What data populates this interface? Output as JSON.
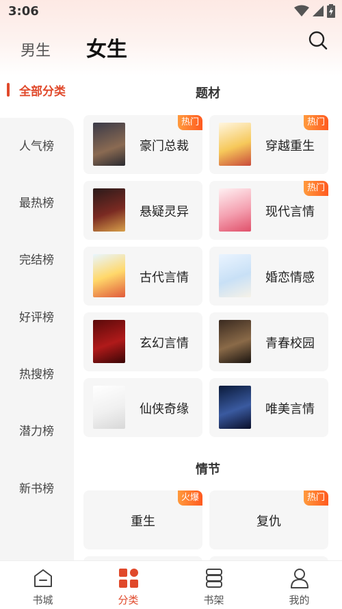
{
  "status_bar": {
    "time": "3:06"
  },
  "header": {
    "tab_male": "男生",
    "tab_female": "女生"
  },
  "sidebar": {
    "active": "全部分类",
    "items": [
      "人气榜",
      "最热榜",
      "完结榜",
      "好评榜",
      "热搜榜",
      "潜力榜",
      "新书榜"
    ]
  },
  "sections": {
    "theme": {
      "title": "题材",
      "cards": [
        {
          "name": "豪门总裁",
          "badge": "热门"
        },
        {
          "name": "穿越重生",
          "badge": "热门"
        },
        {
          "name": "悬疑灵异",
          "badge": ""
        },
        {
          "name": "现代言情",
          "badge": "热门"
        },
        {
          "name": "古代言情",
          "badge": ""
        },
        {
          "name": "婚恋情感",
          "badge": ""
        },
        {
          "name": "玄幻言情",
          "badge": ""
        },
        {
          "name": "青春校园",
          "badge": ""
        },
        {
          "name": "仙侠奇缘",
          "badge": ""
        },
        {
          "name": "唯美言情",
          "badge": ""
        }
      ]
    },
    "plot": {
      "title": "情节",
      "cards": [
        {
          "name": "重生",
          "badge": "火爆"
        },
        {
          "name": "复仇",
          "badge": "热门"
        }
      ]
    }
  },
  "bottom_nav": {
    "items": [
      {
        "label": "书城",
        "icon": "home-icon"
      },
      {
        "label": "分类",
        "icon": "category-icon"
      },
      {
        "label": "书架",
        "icon": "bookshelf-icon"
      },
      {
        "label": "我的",
        "icon": "profile-icon"
      }
    ],
    "active_index": 1
  },
  "colors": {
    "accent": "#e0492b",
    "badge": "#ff6a26"
  }
}
